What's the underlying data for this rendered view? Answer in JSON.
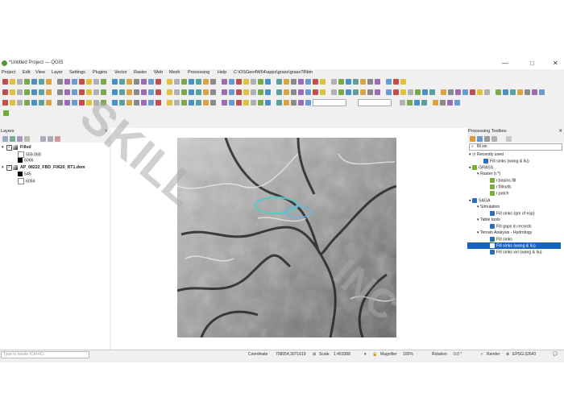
{
  "window": {
    "title": "*Untitled Project — QGIS",
    "minimize_glyph": "—",
    "maximize_glyph": "□",
    "close_glyph": "✕"
  },
  "menu": [
    "Project",
    "Edit",
    "View",
    "Layer",
    "Settings",
    "Plugins",
    "Vector",
    "Raster",
    "Web",
    "Mesh",
    "Processing",
    "Help",
    "C:\\OSGeo4W64\\apps\\grass\\grass78\\bin"
  ],
  "layers_panel": {
    "title": "Layers",
    "layers": [
      {
        "name": "Filled",
        "legend": [
          "559.068",
          "6066"
        ]
      },
      {
        "name": "AP_08222_FBD_F0620_RT1.dem",
        "legend": [
          "545",
          "6056"
        ]
      }
    ]
  },
  "toolbox": {
    "title": "Processing Toolbox",
    "search_value": "fill sin",
    "recently_used_label": "Recently used",
    "recent_item": "Fill sinks (wang & liu)",
    "grass_label": "GRASS",
    "raster_label": "Raster (r.*)",
    "grass_items": [
      "r.basins.fill",
      "r.fillnulls",
      "r.patch"
    ],
    "saga_label": "SAGA",
    "simulation_label": "Simulation",
    "simulation_item": "Fill sinks (qm of esp)",
    "table_tools_label": "Table tools",
    "table_item": "Fill gaps in records",
    "hydrology_label": "Terrain Analysis - Hydrology",
    "hydrology_items": [
      "Fill sinks",
      "Fill sinks (wang & liu)",
      "Fill sinks xxl (wang & liu)"
    ]
  },
  "status": {
    "locator_placeholder": "Type to locate (Ctrl+K)",
    "coordinate_label": "Coordinate",
    "coordinate_value": "708054,3071619",
    "scale_label": "Scale",
    "scale_value": "1:463388",
    "magnifier_label": "Magnifier",
    "magnifier_value": "100%",
    "rotation_label": "Rotation",
    "rotation_value": "0.0 °",
    "render_label": "Render",
    "crs": "EPSG:32643"
  },
  "watermark": [
    "SKILL",
    "INC"
  ],
  "colors": {
    "selection": "#1565c0",
    "qgis_green": "#589632",
    "saga_blue": "#2a6dbb",
    "dem_overlay": "#5fc7c0"
  }
}
